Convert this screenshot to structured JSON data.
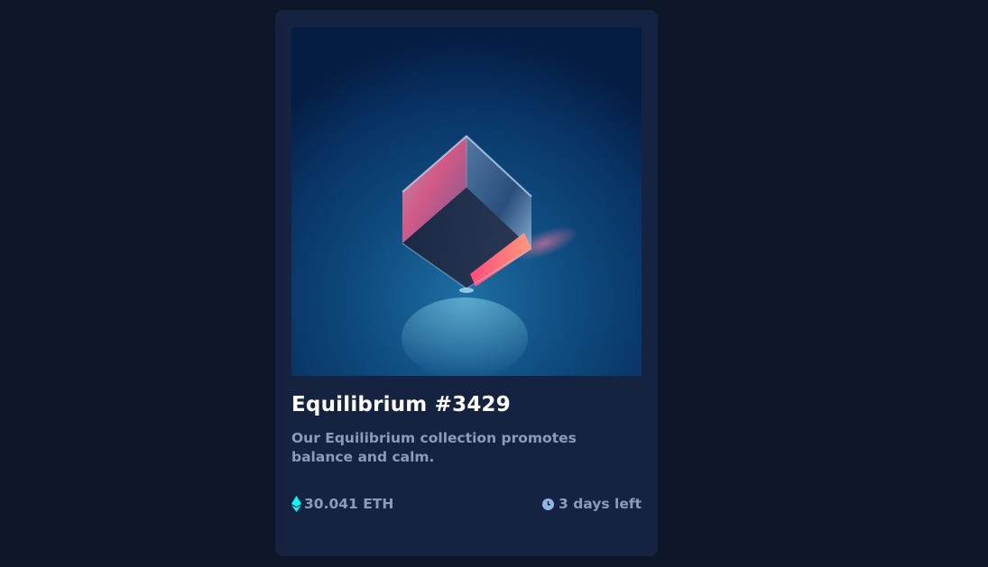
{
  "card": {
    "image_alt": "Equilibrium",
    "title": "Equilibrium #3429",
    "description": "Our Equilibrium collection promotes balance and calm.",
    "price": "30.041 ETH",
    "time_left": "3 days left"
  },
  "icons": {
    "price_icon": "ethereum-icon",
    "time_icon": "clock-icon"
  },
  "colors": {
    "page_background": "#0d1729",
    "card_background": "#152340",
    "accent_cyan": "#00fff8",
    "text_white": "#ffffff",
    "text_muted": "#8b9cb8"
  }
}
